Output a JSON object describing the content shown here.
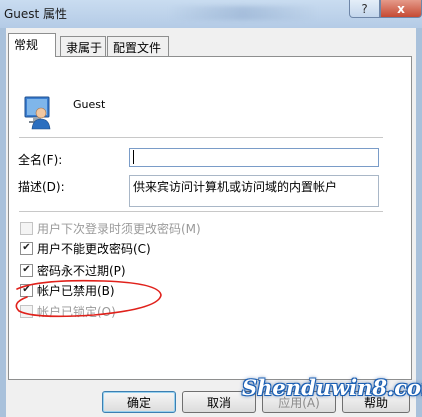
{
  "window": {
    "title": "Guest 属性",
    "help_label": "?",
    "close_label": "x"
  },
  "tabs": [
    {
      "label": "常规",
      "active": true
    },
    {
      "label": "隶属于",
      "active": false
    },
    {
      "label": "配置文件",
      "active": false
    }
  ],
  "user": {
    "name": "Guest"
  },
  "fields": {
    "fullname_label": "全名(F):",
    "fullname_value": "",
    "description_label": "描述(D):",
    "description_value": "供来宾访问计算机或访问域的内置帐户"
  },
  "checkboxes": [
    {
      "label": "用户下次登录时须更改密码(M)",
      "checked": false,
      "enabled": false
    },
    {
      "label": "用户不能更改密码(C)",
      "checked": true,
      "enabled": true
    },
    {
      "label": "密码永不过期(P)",
      "checked": true,
      "enabled": true
    },
    {
      "label": "帐户已禁用(B)",
      "checked": true,
      "enabled": true
    },
    {
      "label": "帐户已锁定(O)",
      "checked": false,
      "enabled": false
    }
  ],
  "buttons": {
    "ok": "确定",
    "cancel": "取消",
    "apply": "应用(A)",
    "help": "帮助"
  },
  "annotation_color": "#e0211b",
  "watermark": "Shenduwin8.com"
}
